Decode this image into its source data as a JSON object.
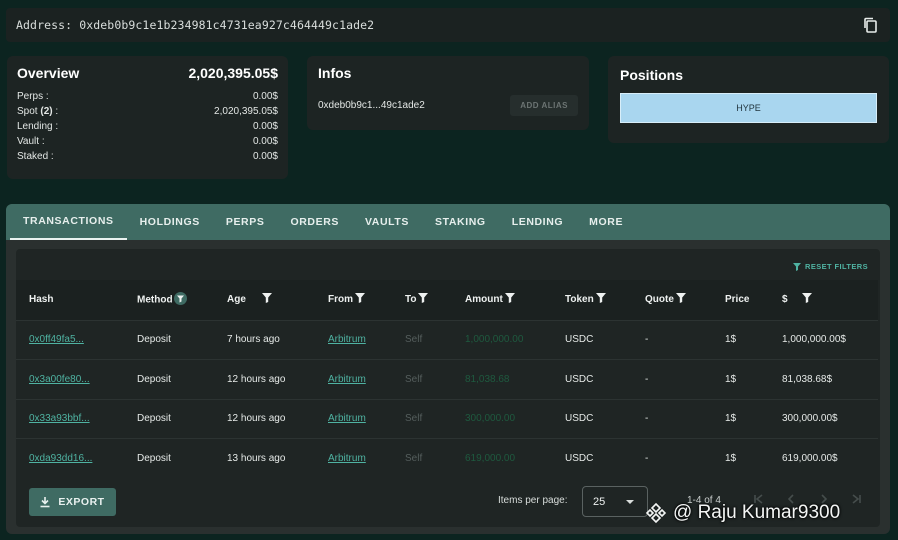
{
  "address": {
    "text": "Address: 0xdeb0b9c1e1b234981c4731ea927c464449c1ade2"
  },
  "overview": {
    "title": "Overview",
    "total": "2,020,395.05$",
    "rows": [
      {
        "label": "Perps :",
        "value": "0.00$"
      },
      {
        "label_pre": "Spot ",
        "label_bold": "(2)",
        "label_post": " :",
        "value": "2,020,395.05$"
      },
      {
        "label": "Lending :",
        "value": "0.00$"
      },
      {
        "label": "Vault :",
        "value": "0.00$"
      },
      {
        "label": "Staked :",
        "value": "0.00$"
      }
    ]
  },
  "infos": {
    "title": "Infos",
    "short_address": "0xdeb0b9c1...49c1ade2",
    "alias_button": "ADD ALIAS"
  },
  "positions": {
    "title": "Positions",
    "items": [
      "HYPE"
    ]
  },
  "tabs": [
    "TRANSACTIONS",
    "HOLDINGS",
    "PERPS",
    "ORDERS",
    "VAULTS",
    "STAKING",
    "LENDING",
    "MORE"
  ],
  "active_tab": "TRANSACTIONS",
  "reset_filters": "RESET FILTERS",
  "table": {
    "columns": [
      "Hash",
      "Method",
      "Age",
      "From",
      "To",
      "Amount",
      "Token",
      "Quote",
      "Price",
      "$"
    ],
    "rows": [
      [
        "0x0ff49fa5...",
        "Deposit",
        "7 hours ago",
        "Arbitrum",
        "Self",
        "1,000,000.00",
        "USDC",
        "-",
        "1$",
        "1,000,000.00$"
      ],
      [
        "0x3a00fe80...",
        "Deposit",
        "12 hours ago",
        "Arbitrum",
        "Self",
        "81,038.68",
        "USDC",
        "-",
        "1$",
        "81,038.68$"
      ],
      [
        "0x33a93bbf...",
        "Deposit",
        "12 hours ago",
        "Arbitrum",
        "Self",
        "300,000.00",
        "USDC",
        "-",
        "1$",
        "300,000.00$"
      ],
      [
        "0xda93dd16...",
        "Deposit",
        "13 hours ago",
        "Arbitrum",
        "Self",
        "619,000.00",
        "USDC",
        "-",
        "1$",
        "619,000.00$"
      ]
    ]
  },
  "footer": {
    "export_label": "EXPORT",
    "items_per_page_label": "Items per page:",
    "items_per_page": "25",
    "range": "1-4 of 4"
  },
  "watermark": "@ Raju Kumar9300",
  "colors": {
    "accent": "#3f6b63",
    "link": "#4fb3a2",
    "chip": "#a9d6ef"
  }
}
